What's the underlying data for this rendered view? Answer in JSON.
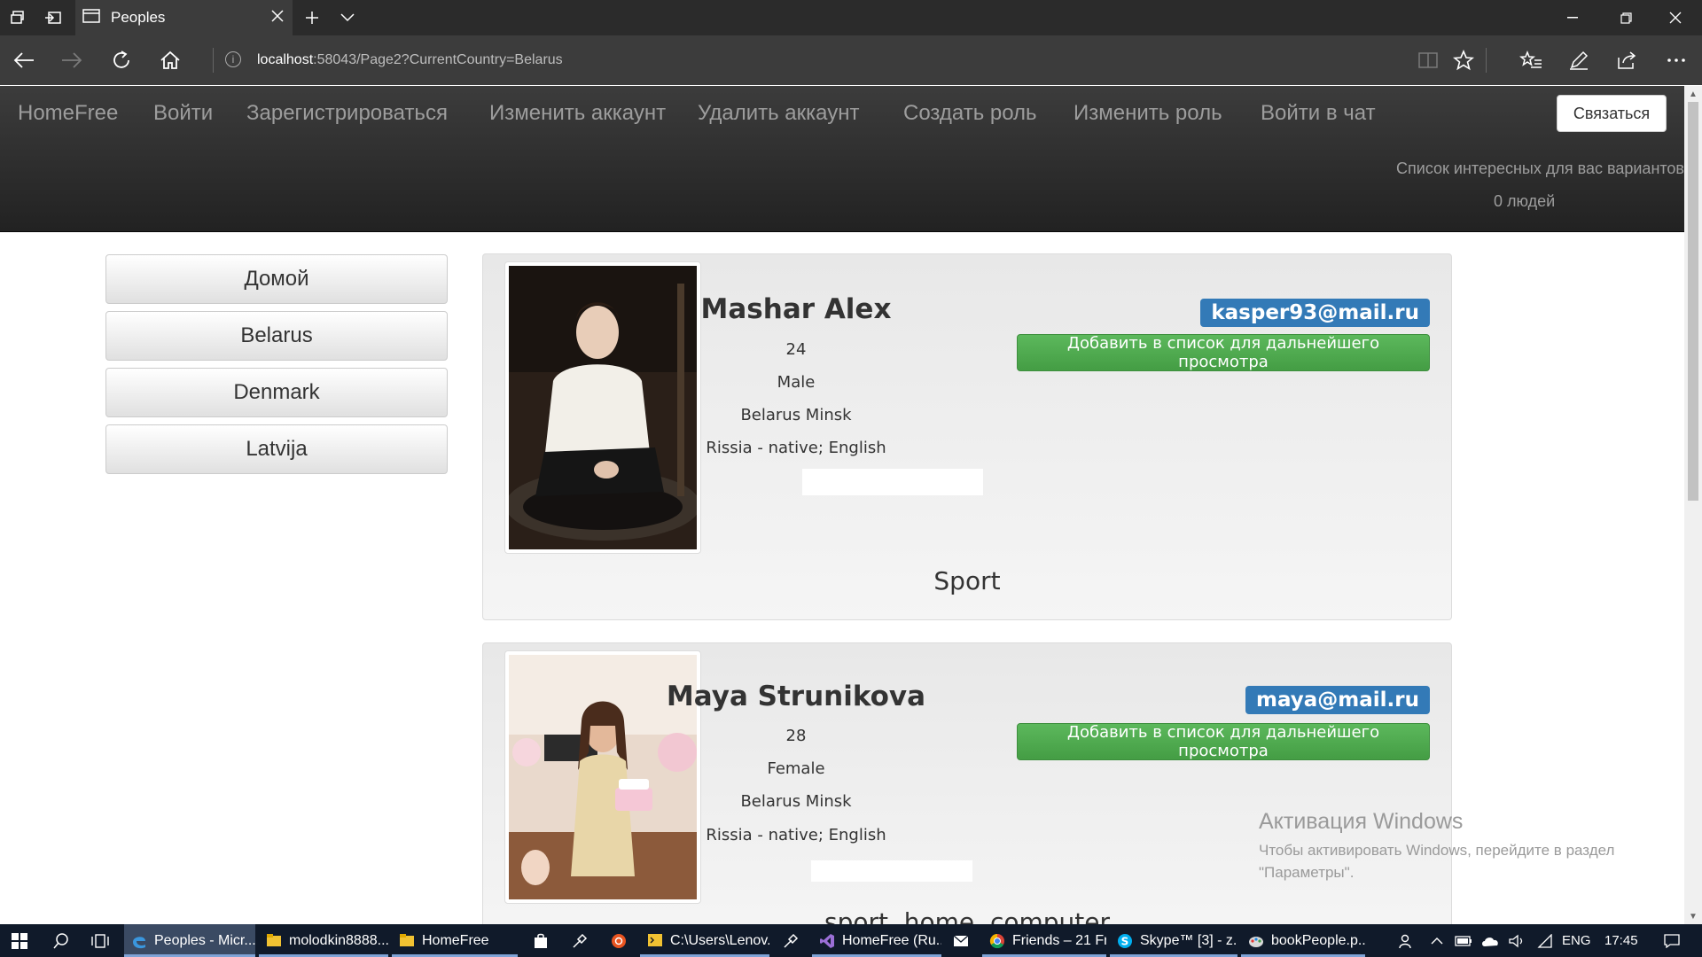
{
  "browser": {
    "tab_title": "Peoples",
    "url_host": "localhost",
    "url_rest": ":58043/Page2?CurrentCountry=Belarus"
  },
  "navbar": {
    "brand": "HomeFree",
    "links": [
      "Войти",
      "Зарегистрироваться",
      "Изменить аккаунт",
      "Удалить аккаунт",
      "Создать роль",
      "Изменить роль",
      "Войти в чат"
    ],
    "contact_button": "Связаться",
    "list_text": "Список интересных для вас вариантов",
    "people_count": "0 людей"
  },
  "sidebar": {
    "items": [
      "Домой",
      "Belarus",
      "Denmark",
      "Latvija"
    ]
  },
  "people": [
    {
      "name": "Mashar Alex",
      "age": "24",
      "gender": "Male",
      "location": "Belarus Minsk",
      "languages": "Rissia - native; English",
      "email": "kasper93@mail.ru",
      "add_button": "Добавить в список для дальнейшего просмотра",
      "interests": "Sport"
    },
    {
      "name": "Maya Strunikova",
      "age": "28",
      "gender": "Female",
      "location": "Belarus Minsk",
      "languages": "Rissia - native; English",
      "email": "maya@mail.ru",
      "add_button": "Добавить в список для дальнейшего просмотра",
      "interests": "sport, home, computer"
    }
  ],
  "activation": {
    "title": "Активация Windows",
    "line1": "Чтобы активировать Windows, перейдите в раздел",
    "line2": "\"Параметры\"."
  },
  "taskbar": {
    "items": [
      "Peoples - Micr...",
      "molodkin8888...",
      "HomeFree",
      "C:\\Users\\Lenov...",
      "HomeFree (Ru...",
      "Friends – 21 Fr...",
      "Skype™ [3] - z...",
      "bookPeople.p..."
    ],
    "language": "ENG",
    "time": "17:45"
  },
  "colors": {
    "navbar_bg": "#222222",
    "email_badge": "#337ab7",
    "add_button": "#5cb85c",
    "taskbar_bg": "#101a2a"
  }
}
